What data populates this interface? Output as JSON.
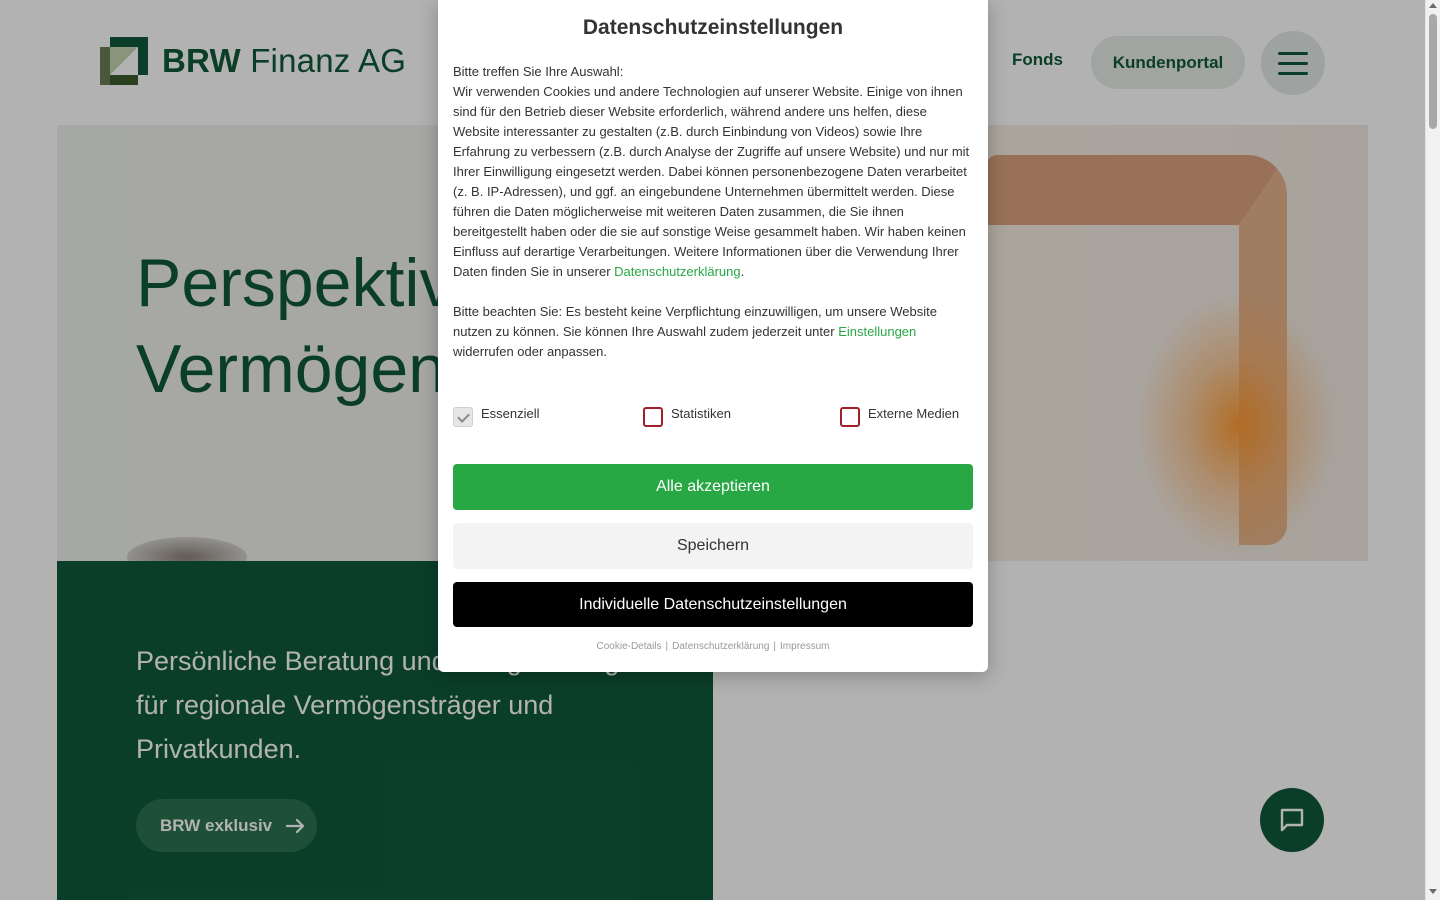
{
  "header": {
    "logo_text_bold": "BRW",
    "logo_text_rest": "Finanz AG",
    "nav_fonds": "Fonds",
    "portal_button": "Kundenportal",
    "menu_icon": "hamburger-menu-icon"
  },
  "hero": {
    "title_line1": "Perspektiv",
    "title_line2": "Vermögen"
  },
  "teaser": {
    "text": "Persönliche Beratung und Anlagestrategien für regionale Vermögensträger und Privatkunden.",
    "button_label": "BRW exklusiv",
    "button_icon": "arrow-right-icon"
  },
  "chat": {
    "icon": "chat-icon"
  },
  "modal": {
    "title": "Datenschutzeinstellungen",
    "intro_heading": "Bitte treffen Sie Ihre Auswahl:",
    "intro_text": "Wir verwenden Cookies und andere Technologien auf unserer Website. Einige von ihnen sind für den Betrieb dieser Website erforderlich, während andere uns helfen, diese Website interessanter zu gestalten (z.B. durch Einbindung von Videos) sowie Ihre Erfahrung zu verbessern (z.B. durch Analyse der Zugriffe auf unsere Website) und nur mit Ihrer Einwilligung eingesetzt werden. Dabei können personenbezogene Daten verarbeitet (z. B. IP-Adressen), und ggf. an eingebundene Unternehmen übermittelt werden. Diese führen die Daten möglicherweise mit weiteren Daten zusammen, die Sie ihnen bereitgestellt haben oder die sie auf sonstige Weise gesammelt haben. Wir haben keinen Einfluss auf derartige Verarbeitungen. Weitere Informationen über die Verwendung Ihrer Daten finden Sie in unserer ",
    "privacy_link": "Datenschutzerklärung",
    "intro_end": ".",
    "note_text": "Bitte beachten Sie: Es besteht keine Verpflichtung einzuwilligen, um unsere Website nutzen zu können. Sie können Ihre Auswahl zudem jederzeit unter ",
    "settings_link": "Einstellungen",
    "note_end": " widerrufen oder anpassen.",
    "checkboxes": [
      {
        "label": "Essenziell",
        "checked": true,
        "disabled": true
      },
      {
        "label": "Statistiken",
        "checked": false,
        "disabled": false
      },
      {
        "label": "Externe Medien",
        "checked": false,
        "disabled": false
      }
    ],
    "accept_all": "Alle akzeptieren",
    "save": "Speichern",
    "individual": "Individuelle Datenschutzeinstellungen",
    "footer_links": [
      "Cookie-Details",
      "Datenschutzerklärung",
      "Impressum"
    ],
    "footer_separator": "|"
  },
  "colors": {
    "brand_green": "#0f5a3c",
    "accept_green": "#28a745",
    "checkbox_border": "#a0202a"
  }
}
